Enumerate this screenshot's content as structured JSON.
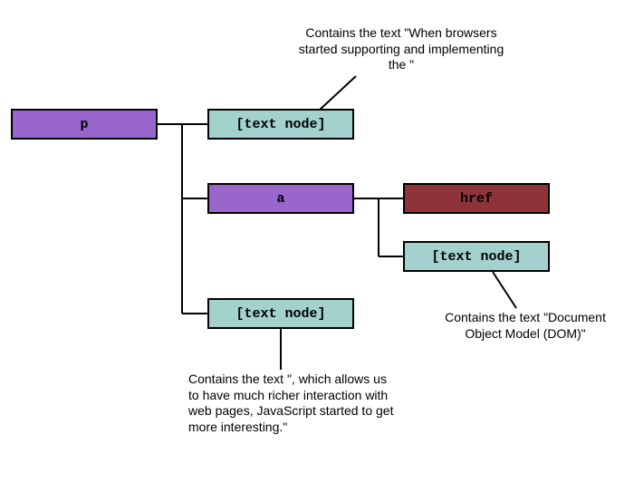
{
  "nodes": {
    "p": "p",
    "text1": "[text node]",
    "a": "a",
    "href": "href",
    "text2": "[text node]",
    "text3": "[text node]"
  },
  "annotations": {
    "top": "Contains the text \"When browsers started supporting and implementing the \"",
    "right": "Contains the text \"Document Object Model (DOM)\"",
    "bottom": "Contains the text \", which allows us to have much richer interaction with web pages, JavaScript started to get more interesting.\""
  },
  "colors": {
    "element": "#9966cc",
    "text": "#a3d1cd",
    "attr": "#8f3338"
  }
}
